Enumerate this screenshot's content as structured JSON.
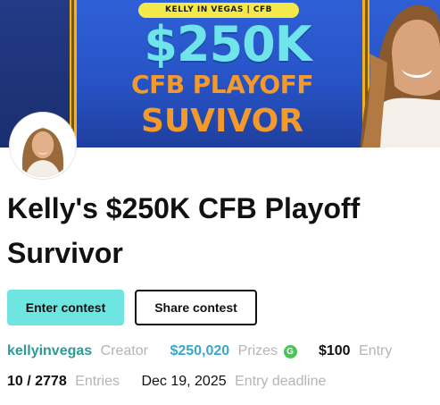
{
  "banner": {
    "tag": "KELLY IN VEGAS | CFB",
    "headline_amount": "$250K",
    "headline_line2": "CFB PLAYOFF",
    "headline_line3": "SUVIVOR",
    "colors": {
      "background": "#2f5fd6",
      "amount": "#6fe4ea",
      "text": "#f39a2b",
      "pill": "#f5e94a",
      "frame": "#f2b21f"
    }
  },
  "contest": {
    "title": "Kelly's $250K CFB Playoff Survivor"
  },
  "actions": {
    "enter_label": "Enter contest",
    "share_label": "Share contest",
    "enter_color": "#6ee5e0"
  },
  "meta": {
    "creator_name": "kellyinvegas",
    "creator_label": "Creator",
    "prizes_value": "$250,020",
    "prizes_label": "Prizes",
    "prizes_badge": "G",
    "entry_fee": "$100",
    "entry_label": "Entry",
    "entries_value": "10 / 2778",
    "entries_label": "Entries",
    "deadline_value": "Dec 19, 2025",
    "deadline_label": "Entry deadline"
  },
  "icons": {
    "avatar": "woman-portrait-icon",
    "prize_badge": "g-coin-icon"
  }
}
